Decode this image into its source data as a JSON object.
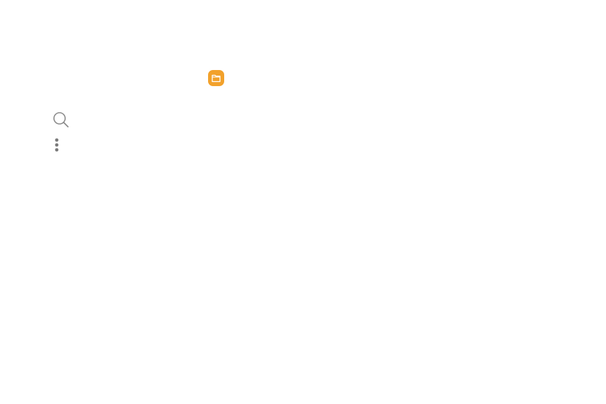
{
  "icons": {
    "app": {
      "name": "my-files-app-icon",
      "color": "#f2a12b"
    },
    "search": {
      "name": "search-icon",
      "color": "#8a8a8a"
    },
    "more": {
      "name": "more-options-icon",
      "color": "#7a7a7a"
    }
  }
}
